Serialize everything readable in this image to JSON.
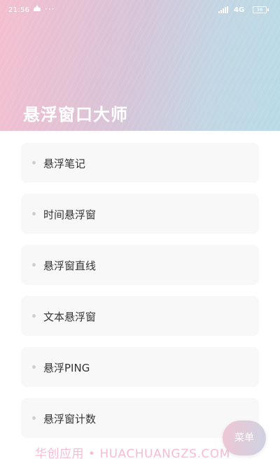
{
  "status_bar": {
    "time": "21:56",
    "dots": "···",
    "network": "4G",
    "battery": "36"
  },
  "header": {
    "title": "悬浮窗口大师"
  },
  "menu": {
    "items": [
      {
        "label": "悬浮笔记"
      },
      {
        "label": "时间悬浮窗"
      },
      {
        "label": "悬浮窗直线"
      },
      {
        "label": "文本悬浮窗"
      },
      {
        "label": "悬浮PING"
      },
      {
        "label": "悬浮窗计数"
      }
    ]
  },
  "watermark": {
    "text": "华创应用 • HUACHUANGZS.COM"
  },
  "fab": {
    "label": "菜单"
  },
  "colors": {
    "header_gradient_start": "#f4bfcf",
    "header_gradient_end": "#b9dbe6",
    "card_background": "#f8f8f8",
    "text": "#333333"
  },
  "icons": [
    "notification-icon",
    "signal-icon",
    "battery-icon",
    "bullet-icon"
  ]
}
